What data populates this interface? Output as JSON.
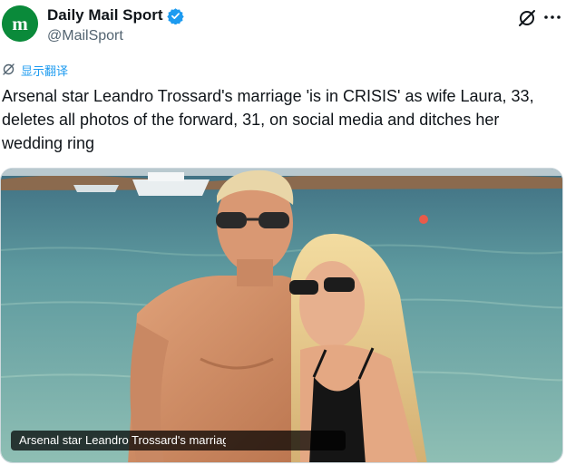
{
  "account": {
    "display_name": "Daily Mail Sport",
    "handle": "@MailSport",
    "avatar_icon": "daily-mail-m-logo",
    "verified": true,
    "brand_color": "#0a8a3a",
    "verified_color": "#1d9bf0"
  },
  "actions": {
    "grok_icon": "grok-icon",
    "more_icon": "more-icon"
  },
  "translate": {
    "label": "显示翻译",
    "icon": "translate-icon"
  },
  "tweet": {
    "text": "Arsenal star Leandro Trossard's marriage 'is in CRISIS' as wife Laura, 33,\ndeletes all photos of the forward, 31, on social media and ditches her\nwedding ring"
  },
  "media": {
    "caption": "Arsenal star Leandro Trossard's marriage"
  }
}
